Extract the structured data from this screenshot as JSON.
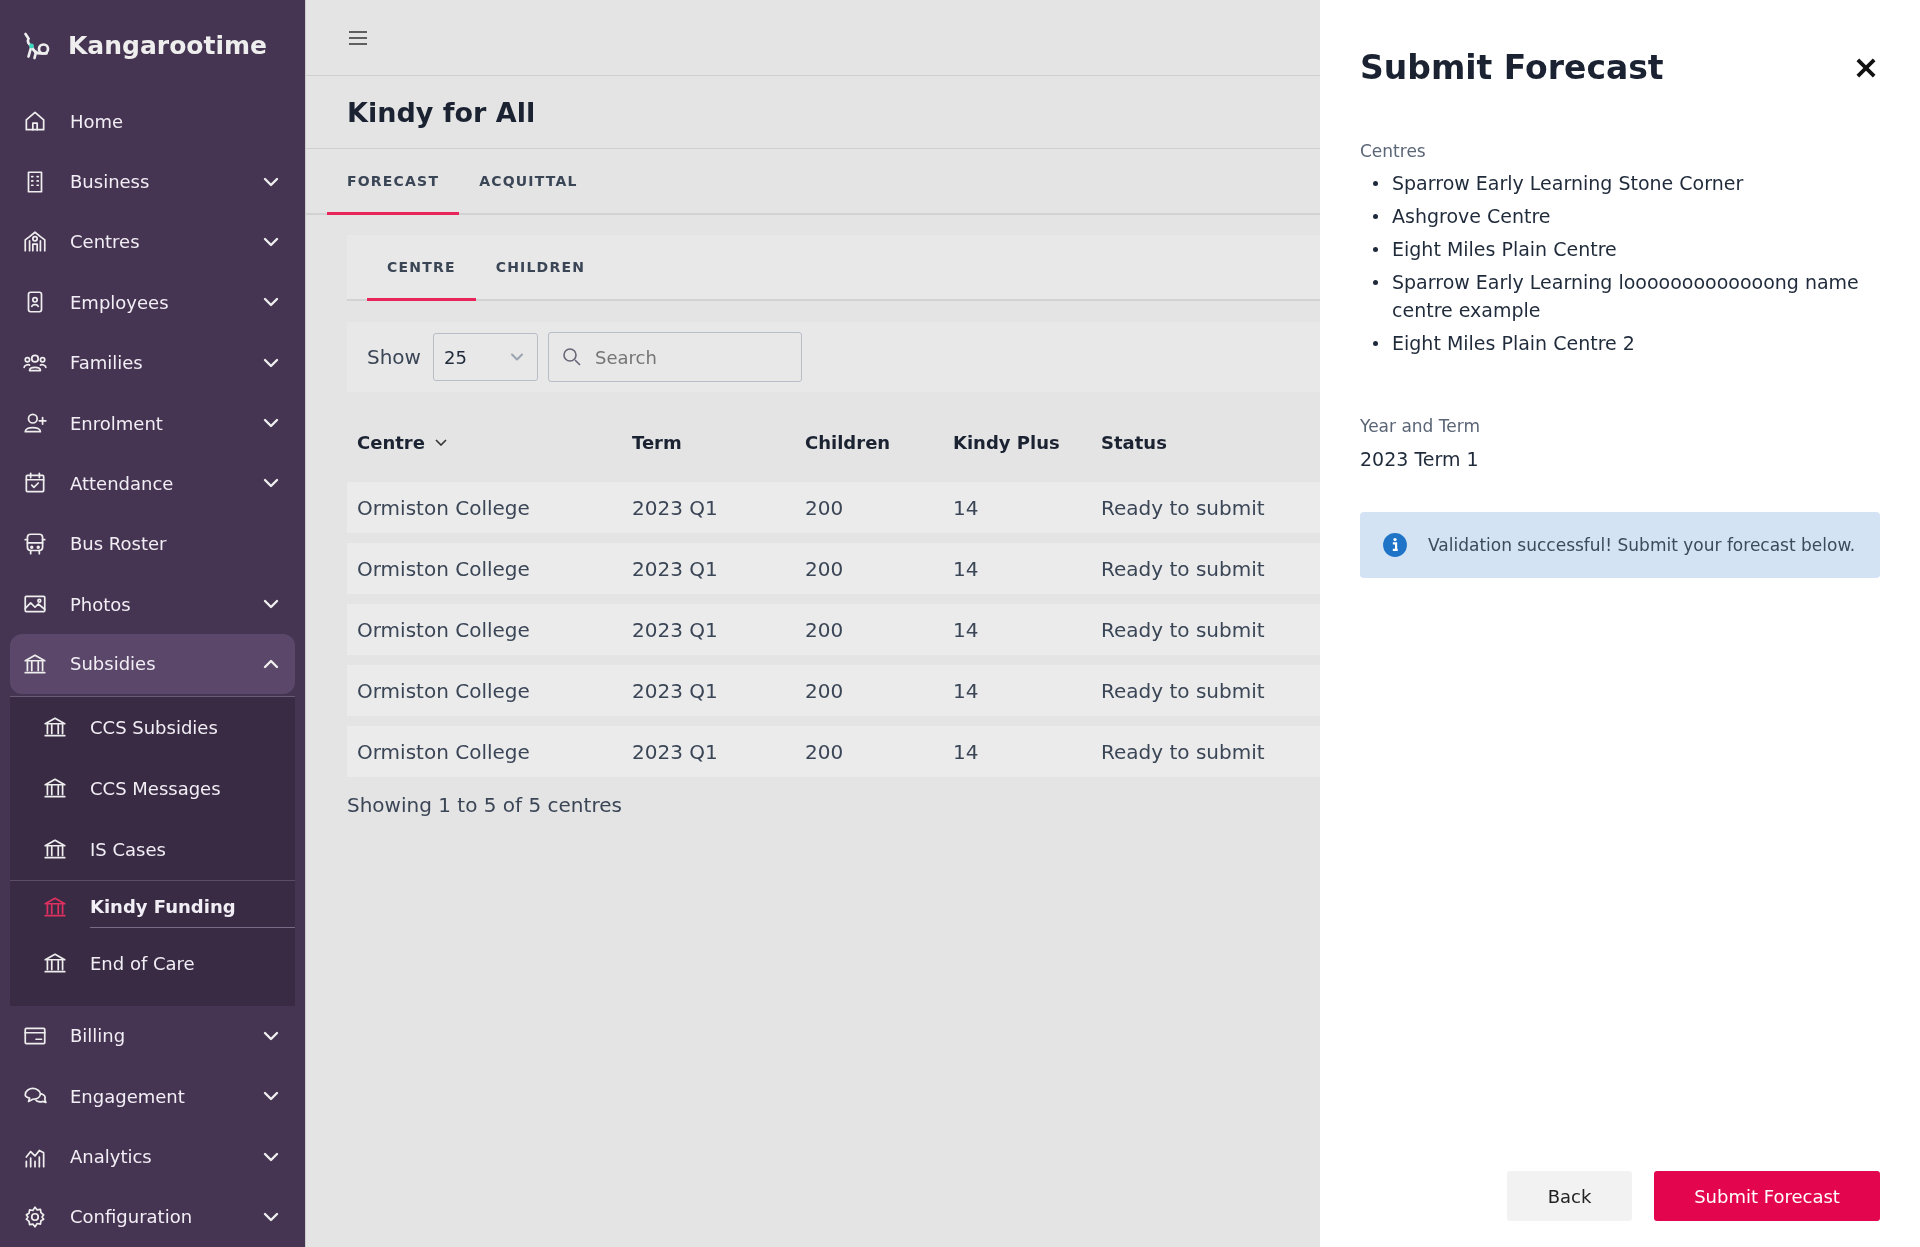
{
  "brand": "Kangarootime",
  "nav": [
    {
      "label": "Home",
      "expandable": false,
      "expanded": false
    },
    {
      "label": "Business",
      "expandable": true,
      "expanded": false
    },
    {
      "label": "Centres",
      "expandable": true,
      "expanded": false
    },
    {
      "label": "Employees",
      "expandable": true,
      "expanded": false
    },
    {
      "label": "Families",
      "expandable": true,
      "expanded": false
    },
    {
      "label": "Enrolment",
      "expandable": true,
      "expanded": false
    },
    {
      "label": "Attendance",
      "expandable": true,
      "expanded": false
    },
    {
      "label": "Bus Roster",
      "expandable": false,
      "expanded": false
    },
    {
      "label": "Photos",
      "expandable": true,
      "expanded": false
    },
    {
      "label": "Subsidies",
      "expandable": true,
      "expanded": true,
      "children": [
        {
          "label": "CCS Subsidies",
          "selected": false
        },
        {
          "label": "CCS Messages",
          "selected": false
        },
        {
          "label": "IS Cases",
          "selected": false
        },
        {
          "label": "Kindy Funding",
          "selected": true
        },
        {
          "label": "End of Care",
          "selected": false
        }
      ]
    },
    {
      "label": "Billing",
      "expandable": true,
      "expanded": false
    },
    {
      "label": "Engagement",
      "expandable": true,
      "expanded": false
    },
    {
      "label": "Analytics",
      "expandable": true,
      "expanded": false
    },
    {
      "label": "Configuration",
      "expandable": true,
      "expanded": false
    }
  ],
  "page_title": "Kindy for All",
  "tabs": [
    {
      "label": "FORECAST",
      "selected": true
    },
    {
      "label": "ACQUITTAL",
      "selected": false
    }
  ],
  "subtabs": [
    {
      "label": "CENTRE",
      "selected": true
    },
    {
      "label": "CHILDREN",
      "selected": false
    }
  ],
  "show_label": "Show",
  "page_size": "25",
  "search": {
    "placeholder": "Search"
  },
  "table": {
    "columns": [
      {
        "label": "Centre",
        "sorted": true
      },
      {
        "label": "Term",
        "sorted": false
      },
      {
        "label": "Children",
        "sorted": false
      },
      {
        "label": "Kindy Plus",
        "sorted": false
      },
      {
        "label": "Status",
        "sorted": false
      }
    ],
    "rows": [
      [
        "Ormiston College",
        "2023 Q1",
        "200",
        "14",
        "Ready to submit"
      ],
      [
        "Ormiston College",
        "2023 Q1",
        "200",
        "14",
        "Ready to submit"
      ],
      [
        "Ormiston College",
        "2023 Q1",
        "200",
        "14",
        "Ready to submit"
      ],
      [
        "Ormiston College",
        "2023 Q1",
        "200",
        "14",
        "Ready to submit"
      ],
      [
        "Ormiston College",
        "2023 Q1",
        "200",
        "14",
        "Ready to submit"
      ]
    ]
  },
  "table_footer": "Showing 1 to 5 of 5 centres",
  "panel": {
    "title": "Submit Forecast",
    "centres_label": "Centres",
    "centres": [
      "Sparrow Early Learning Stone Corner",
      "Ashgrove Centre",
      "Eight Miles Plain Centre",
      "Sparrow Early Learning looooooooooooong name centre example",
      "Eight Miles Plain Centre 2"
    ],
    "term_label": "Year and Term",
    "term": "2023 Term 1",
    "alert": "Validation successful! Submit your forecast below.",
    "buttons": [
      {
        "label": "Back",
        "kind": "secondary"
      },
      {
        "label": "Submit Forecast",
        "kind": "primary"
      }
    ]
  }
}
